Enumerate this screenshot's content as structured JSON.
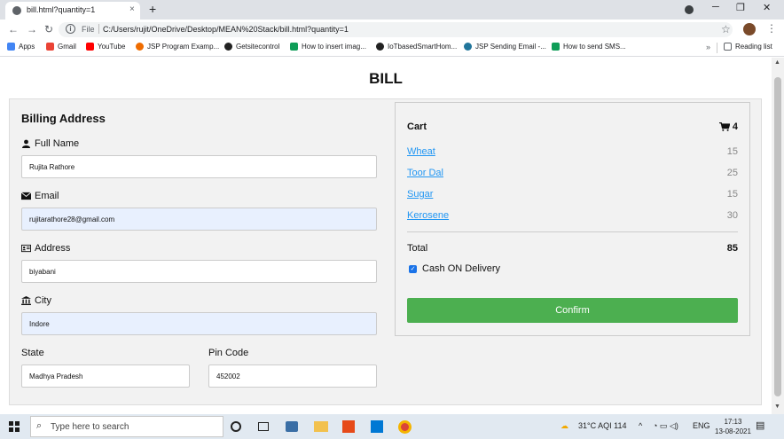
{
  "browser": {
    "tab_title": "bill.html?quantity=1",
    "tab_close": "×",
    "new_tab": "+",
    "win_minimize": "─",
    "win_restore": "❐",
    "win_close": "✕",
    "nav_back": "←",
    "nav_forward": "→",
    "nav_reload": "↻",
    "file_label": "File",
    "url": "C:/Users/rujit/OneDrive/Desktop/MEAN%20Stack/bill.html?quantity=1",
    "bookmarks": [
      {
        "label": "Apps",
        "color": "#4285f4"
      },
      {
        "label": "Gmail",
        "color": "#ea4335"
      },
      {
        "label": "YouTube",
        "color": "#ff0000"
      },
      {
        "label": "JSP Program Examp...",
        "color": "#ef6c00"
      },
      {
        "label": "Getsitecontrol",
        "color": "#222222"
      },
      {
        "label": "How to insert imag...",
        "color": "#0f9d58"
      },
      {
        "label": "IoTbasedSmartHom...",
        "color": "#222222"
      },
      {
        "label": "JSP Sending Email -...",
        "color": "#21759b"
      },
      {
        "label": "How to send SMS...",
        "color": "#0f9d58"
      }
    ],
    "bookmarks_more": "»",
    "reading_list": "Reading list"
  },
  "page": {
    "title": "BILL",
    "billing_heading": "Billing Address",
    "full_name_label": "Full Name",
    "full_name_value": "Rujita Rathore",
    "email_label": "Email",
    "email_value": "rujitarathore28@gmail.com",
    "address_label": "Address",
    "address_value": "biyabani",
    "city_label": "City",
    "city_value": "Indore",
    "state_label": "State",
    "state_value": "Madhya Pradesh",
    "pin_label": "Pin Code",
    "pin_value": "452002"
  },
  "cart": {
    "title": "Cart",
    "count": "4",
    "items": [
      {
        "name": "Wheat",
        "price": "15"
      },
      {
        "name": "Toor Dal",
        "price": "25"
      },
      {
        "name": "Sugar",
        "price": "15"
      },
      {
        "name": "Kerosene",
        "price": "30"
      }
    ],
    "total_label": "Total",
    "total_value": "85",
    "payment_label": "Cash ON Delivery",
    "payment_checked": true,
    "confirm_label": "Confirm"
  },
  "taskbar": {
    "search_placeholder": "Type here to search",
    "weather": "31°C  AQI 114",
    "language": "ENG",
    "time": "17:13",
    "date": "13-08-2021"
  },
  "colors": {
    "accent_green": "#4caf50",
    "link_blue": "#2196F3",
    "autofill_blue": "#e8f0fe"
  }
}
